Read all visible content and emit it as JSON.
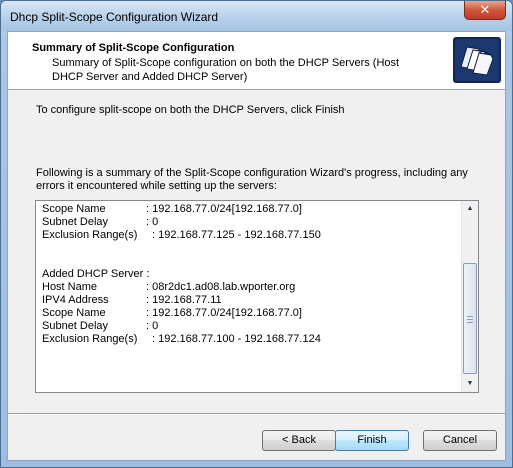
{
  "window": {
    "title": "Dhcp Split-Scope Configuration Wizard",
    "close_glyph": "✕"
  },
  "header": {
    "title": "Summary of Split-Scope Configuration",
    "description": "Summary of Split-Scope configuration on both the DHCP Servers (Host DHCP Server and Added DHCP Server)"
  },
  "instruction": "To configure split-scope on both the DHCP Servers, click Finish",
  "summary_intro": "Following is a summary of the Split-Scope configuration Wizard's progress, including any errors it encountered while setting up the servers:",
  "log": {
    "lines": [
      {
        "key": "Scope Name",
        "value": ": 192.168.77.0/24[192.168.77.0]"
      },
      {
        "key": "Subnet Delay",
        "value": ": 0"
      },
      {
        "key": "Exclusion Range(s)",
        "value": ": 192.168.77.125 - 192.168.77.150"
      },
      {
        "key": "",
        "value": ""
      },
      {
        "key": "",
        "value": ""
      },
      {
        "key": "Added DHCP Server :",
        "value": ""
      },
      {
        "key": "Host Name",
        "value": ": 08r2dc1.ad08.lab.wporter.org"
      },
      {
        "key": "IPV4 Address",
        "value": ": 192.168.77.11"
      },
      {
        "key": "Scope Name",
        "value": ": 192.168.77.0/24[192.168.77.0]"
      },
      {
        "key": "Subnet Delay",
        "value": ": 0"
      },
      {
        "key": "Exclusion Range(s)",
        "value": ": 192.168.77.100 - 192.168.77.124"
      }
    ]
  },
  "buttons": {
    "back": "< Back",
    "finish": "Finish",
    "cancel": "Cancel"
  }
}
